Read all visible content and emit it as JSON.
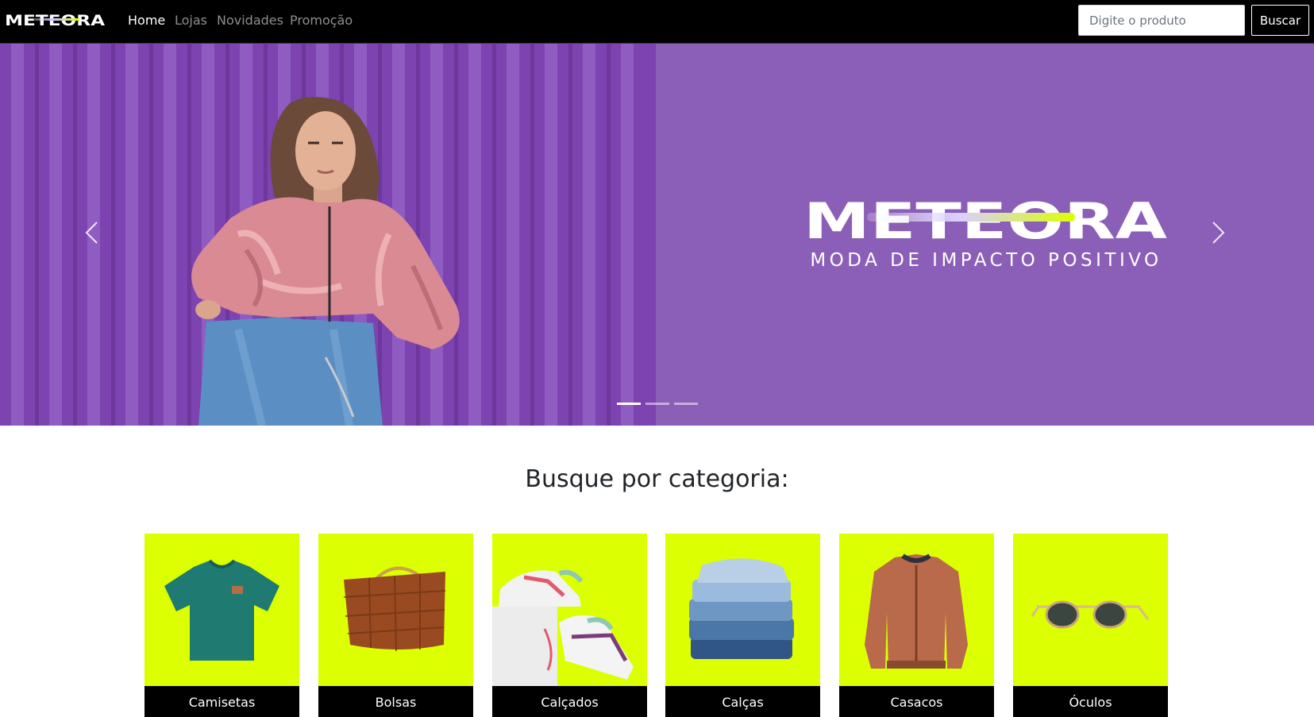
{
  "navbar": {
    "brand": "METEORA",
    "links": [
      {
        "label": "Home",
        "active": true
      },
      {
        "label": "Lojas",
        "active": false
      },
      {
        "label": "Novidades",
        "active": false
      },
      {
        "label": "Promoção",
        "active": false
      }
    ],
    "search": {
      "placeholder": "Digite o produto",
      "value": ""
    },
    "search_button": "Buscar"
  },
  "carousel": {
    "wordmark": "METEORA",
    "tagline": "MODA DE IMPACTO POSITIVO",
    "slide_count": 3,
    "active_slide": 1,
    "prev_icon": "chevron-left-icon",
    "next_icon": "chevron-right-icon"
  },
  "categories": {
    "title": "Busque por categoria:",
    "items": [
      {
        "label": "Camisetas",
        "icon": "tshirt-icon"
      },
      {
        "label": "Bolsas",
        "icon": "handbag-icon"
      },
      {
        "label": "Calçados",
        "icon": "sneaker-icon"
      },
      {
        "label": "Calças",
        "icon": "jeans-icon"
      },
      {
        "label": "Casacos",
        "icon": "jacket-icon"
      },
      {
        "label": "Óculos",
        "icon": "sunglasses-icon"
      }
    ]
  },
  "colors": {
    "navbar_bg": "#000000",
    "hero_purple": "#8b5fb7",
    "accent_lime": "#dcff01",
    "label_bg": "#000000"
  }
}
